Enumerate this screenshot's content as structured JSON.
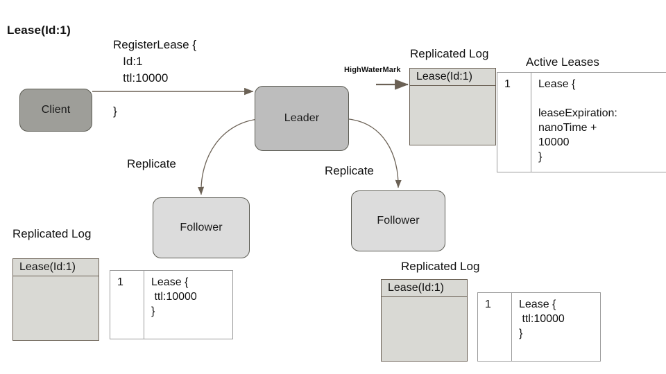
{
  "diagram": {
    "title": "Lease(Id:1)",
    "colors": {
      "client_fill": "#9e9e99",
      "leader_fill": "#bdbdbd",
      "follower_fill": "#dcdcdc",
      "log_fill": "#d9d9d4",
      "log_border": "#6b6155",
      "arrow": "#6b6155",
      "table_border": "#9a9a9a"
    },
    "nodes": {
      "client": "Client",
      "leader": "Leader",
      "follower_left": "Follower",
      "follower_right": "Follower"
    },
    "messages": {
      "register_lease": "RegisterLease {\n   Id:1\n   ttl:10000\n\n}",
      "replicate_left": "Replicate",
      "replicate_right": "Replicate",
      "high_water_mark": "HighWaterMark"
    },
    "logs": {
      "leader": {
        "title": "Replicated Log",
        "entries": [
          "Lease(Id:1)"
        ]
      },
      "follower_left": {
        "title": "Replicated Log",
        "entries": [
          "Lease(Id:1)"
        ]
      },
      "follower_right": {
        "title": "Replicated Log",
        "entries": [
          "Lease(Id:1)"
        ]
      }
    },
    "tables": {
      "active_leases": {
        "title": "Active Leases",
        "rows": [
          {
            "index": "1",
            "value": "Lease {\n\nleaseExpiration:\nnanoTime +\n10000\n}"
          }
        ]
      },
      "follower_left_state": {
        "rows": [
          {
            "index": "1",
            "value": "Lease {\n ttl:10000\n}"
          }
        ]
      },
      "follower_right_state": {
        "rows": [
          {
            "index": "1",
            "value": "Lease {\n ttl:10000\n}"
          }
        ]
      }
    }
  }
}
